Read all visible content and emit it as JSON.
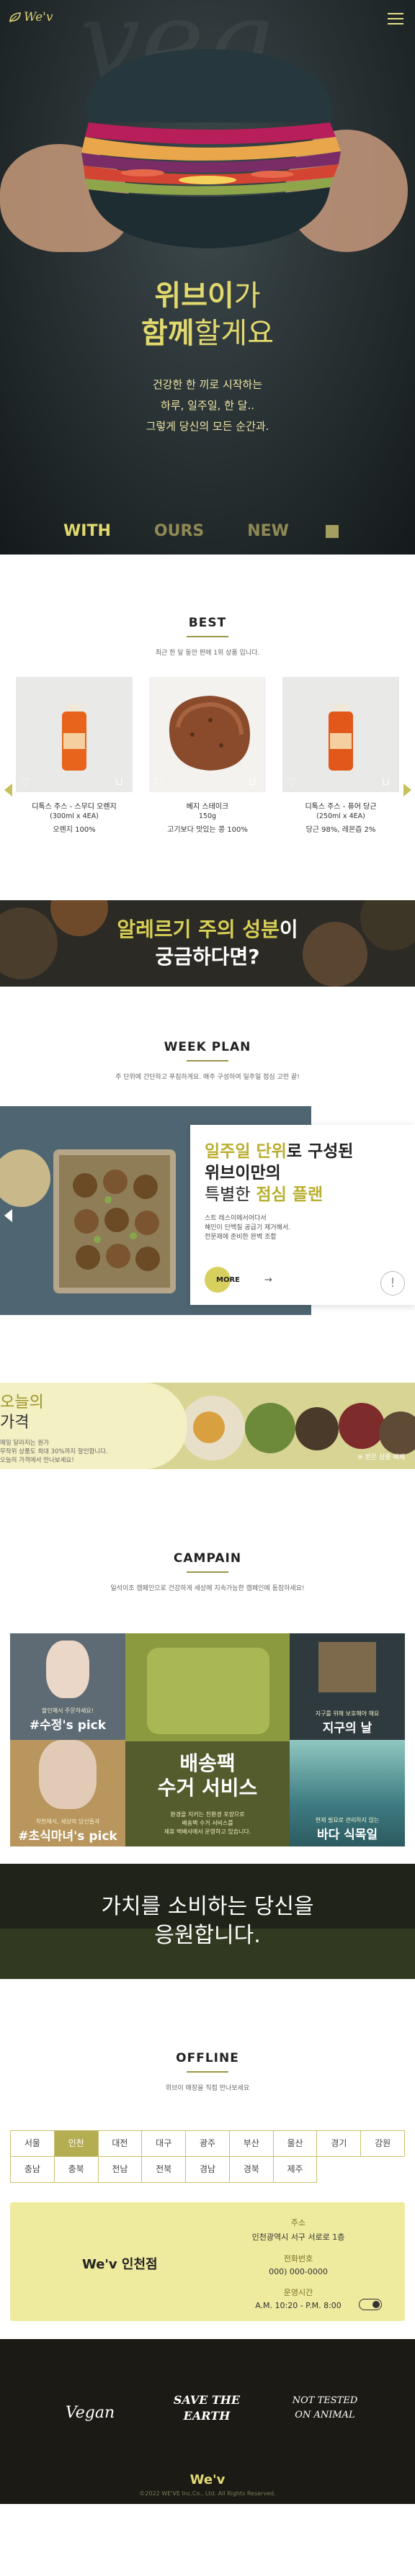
{
  "header": {
    "logo_text": "We'v",
    "menu_icon": "hamburger-icon"
  },
  "hero": {
    "title_line1_bold": "위브이",
    "title_line1_light": "가",
    "title_line2_bold": "함께",
    "title_line2_light": "할게요",
    "desc_lines": [
      "건강한 한 끼로 시작하는",
      "하루, 일주일, 한 달..",
      "그렇게 당신의 모든 순간과."
    ],
    "tabs": [
      "WITH",
      "OURS",
      "NEW"
    ],
    "active_tab": "WITH"
  },
  "best": {
    "title": "BEST",
    "subtitle": "최근 한 달 동안 판매 1위 상품 입니다.",
    "products": [
      {
        "name": "디톡스 주스 - 스무디 오렌지",
        "option": "(300ml x 4EA)",
        "info": "오렌지 100%"
      },
      {
        "name": "베지 스테이크",
        "option": "150g",
        "info": "고기보다 맛있는 콩 100%"
      },
      {
        "name": "디톡스 주스 - 퓨어 당근",
        "option": "(250ml x 4EA)",
        "info": "당근 98%, 레몬즙 2%"
      }
    ]
  },
  "allergy": {
    "line1_hl": "알레르기 주의 성분",
    "line1_rest": "이",
    "line2": "궁금하다면?"
  },
  "weekplan": {
    "title": "WEEK PLAN",
    "subtitle": "주 단위에 간단하고 푸짐하게요. 매주 구성하여 일주일 점심 고민 끝!",
    "headline_hl": "일주일 단위",
    "headline_rest1": "로 구성된",
    "headline_line2": "위브이만의",
    "headline_line3_thin": "특별한",
    "headline_line3_hl": "점심 플랜",
    "body_lines": [
      "스트 레스이에서어다서",
      "혜인이 단백질 공급기 제거해서.",
      "전문제에 준비한 완벽 조합"
    ],
    "more_label": "MORE"
  },
  "price": {
    "title_bold": "오늘의",
    "title_line2": "가격",
    "desc_lines": [
      "매일 달라지는 원가",
      "무작위 상품도 최대 30%까지 할인합니다.",
      "오늘의 가격에서 만나보세요!"
    ],
    "tag": "※ 본은 상품 예제"
  },
  "campain": {
    "title": "CAMPAIN",
    "subtitle": "일석이조 캠페인으로 건강하게 세상에 지속가능한 캠페인에 동참하세요!",
    "cells": [
      {
        "small": "할인해서 주문하세요!",
        "big": "#수정's pick"
      },
      {
        "small": "배송팩",
        "big": "수거 서비스"
      },
      {
        "small": "지구를 위해 보호해야 해요",
        "big": "지구의 날"
      },
      {
        "small": "착한채식, 세상의 당신들과",
        "big": "#초식마녀's pick"
      },
      {
        "small": "현재 필요로 관리하지 않는",
        "big": "바다 식목일"
      }
    ],
    "delivery_note_lines": [
      "환경을 지키는 친환경 포장으로",
      "배송팩 수거 서비스를",
      "제휴 택배사에서 운영하고 있습니다."
    ]
  },
  "consumer": {
    "line1": "가치를 소비하는 당신을",
    "line2": "응원합니다."
  },
  "offline": {
    "title": "OFFLINE",
    "subtitle": "위브이 매장을 직접 만나보세요",
    "regions": [
      "서울",
      "인천",
      "대전",
      "대구",
      "광주",
      "부산",
      "울산",
      "경기",
      "강원",
      "충남",
      "충북",
      "전남",
      "전북",
      "경남",
      "경북",
      "제주"
    ],
    "active_region": "인천",
    "store": {
      "name": "We'v 인천점",
      "address_label": "주소",
      "address": "인천광역시 서구 서로로 1층",
      "phone_label": "전화번호",
      "phone": "000) 000-0000",
      "hours_label": "운영시간",
      "hours": "A.M. 10:20 - P.M. 8:00"
    }
  },
  "footer": {
    "signatures": [
      "Vegan",
      "SAVE THE EARTH",
      "NOT TESTED ON ANIMAL"
    ],
    "brand": "We'v",
    "copyright": "©2022 WE'VE Inc.Co., Ltd. All Rights Reserved."
  },
  "colors": {
    "accent": "#d8cf55",
    "accent_dark": "#9a9346",
    "hero_bg": "#2a3335",
    "footer_bg": "#1b1a14"
  }
}
